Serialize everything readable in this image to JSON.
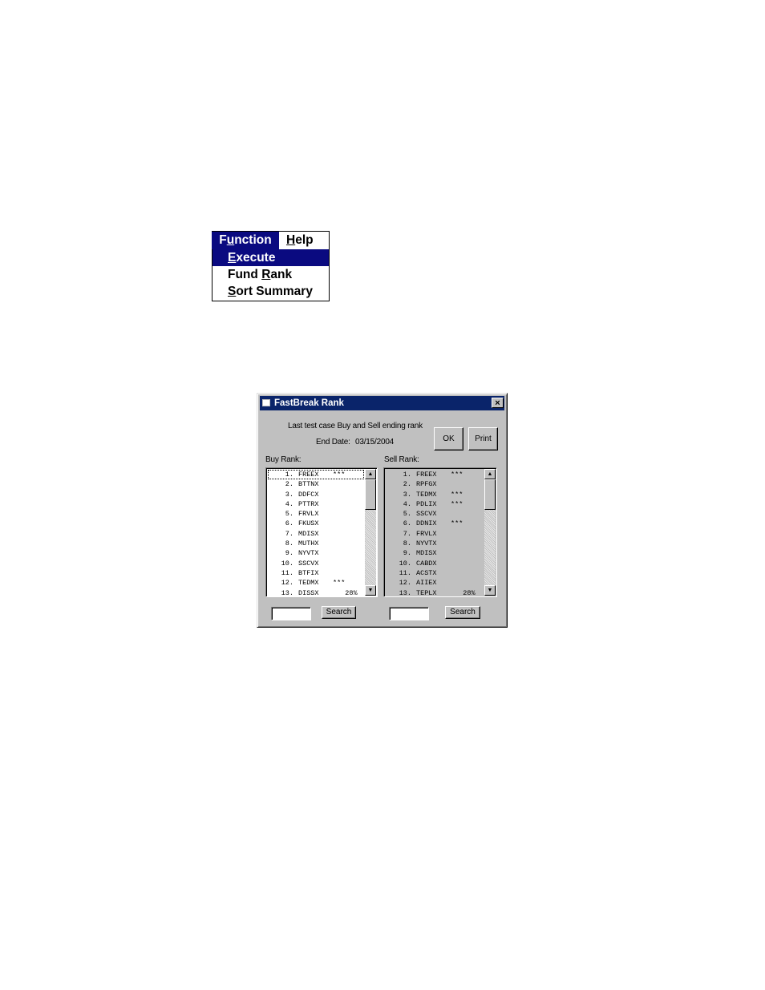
{
  "menu": {
    "bar": [
      {
        "pre": "F",
        "ul": "u",
        "post": "nction"
      },
      {
        "pre": "",
        "ul": "H",
        "post": "elp"
      }
    ],
    "items": [
      {
        "pre": "",
        "ul": "E",
        "post": "xecute"
      },
      {
        "pre": "Fund ",
        "ul": "R",
        "post": "ank"
      },
      {
        "pre": "",
        "ul": "S",
        "post": "ort Summary"
      }
    ]
  },
  "dialog": {
    "title": "FastBreak Rank",
    "close": "×",
    "heading": "Last test case Buy and Sell ending rank",
    "end_date_label": "End Date:",
    "end_date": "03/15/2004",
    "ok_label": "OK",
    "print_label": "Print",
    "buy_label": "Buy Rank:",
    "sell_label": "Sell Rank:",
    "buy_search_label": "Search",
    "sell_search_label": "Search",
    "buy_search_value": "",
    "sell_search_value": "",
    "scroll_up": "▲",
    "scroll_down": "▼",
    "buy_list": [
      {
        "n": "1.",
        "sym": "FREEX",
        "mark": "***"
      },
      {
        "n": "2.",
        "sym": "BTTNX",
        "mark": ""
      },
      {
        "n": "3.",
        "sym": "DDFCX",
        "mark": ""
      },
      {
        "n": "4.",
        "sym": "PTTRX",
        "mark": ""
      },
      {
        "n": "5.",
        "sym": "FRVLX",
        "mark": ""
      },
      {
        "n": "6.",
        "sym": "FKUSX",
        "mark": ""
      },
      {
        "n": "7.",
        "sym": "MDISX",
        "mark": ""
      },
      {
        "n": "8.",
        "sym": "MUTHX",
        "mark": ""
      },
      {
        "n": "9.",
        "sym": "NYVTX",
        "mark": ""
      },
      {
        "n": "10.",
        "sym": "SSCVX",
        "mark": ""
      },
      {
        "n": "11.",
        "sym": "BTFIX",
        "mark": ""
      },
      {
        "n": "12.",
        "sym": "TEDMX",
        "mark": "***"
      },
      {
        "n": "13.",
        "sym": "DISSX",
        "mark": "   28%"
      }
    ],
    "sell_list": [
      {
        "n": "1.",
        "sym": "FREEX",
        "mark": "***"
      },
      {
        "n": "2.",
        "sym": "RPFGX",
        "mark": ""
      },
      {
        "n": "3.",
        "sym": "TEDMX",
        "mark": "***"
      },
      {
        "n": "4.",
        "sym": "PDLIX",
        "mark": "***"
      },
      {
        "n": "5.",
        "sym": "SSCVX",
        "mark": ""
      },
      {
        "n": "6.",
        "sym": "DDNIX",
        "mark": "***"
      },
      {
        "n": "7.",
        "sym": "FRVLX",
        "mark": ""
      },
      {
        "n": "8.",
        "sym": "NYVTX",
        "mark": ""
      },
      {
        "n": "9.",
        "sym": "MDISX",
        "mark": ""
      },
      {
        "n": "10.",
        "sym": "CABDX",
        "mark": ""
      },
      {
        "n": "11.",
        "sym": "ACSTX",
        "mark": ""
      },
      {
        "n": "12.",
        "sym": "AIIEX",
        "mark": ""
      },
      {
        "n": "13.",
        "sym": "TEPLX",
        "mark": "   28%"
      }
    ]
  }
}
